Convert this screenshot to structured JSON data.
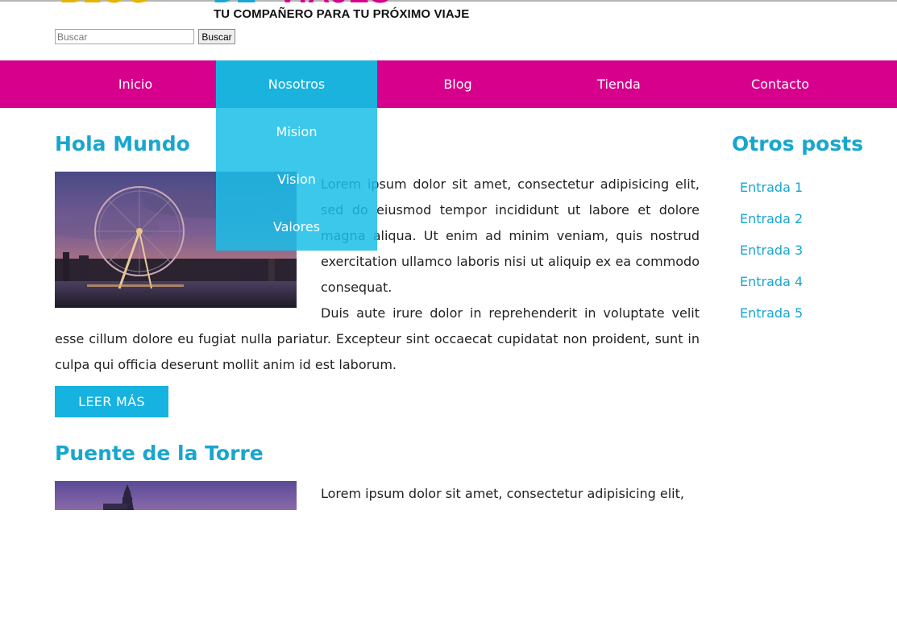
{
  "header": {
    "logo_parts": [
      "BLOG",
      "DE",
      "VIAJES"
    ],
    "tagline": "TU COMPAÑERO PARA TU PRÓXIMO VIAJE",
    "search": {
      "placeholder": "Buscar",
      "button_label": "Buscar"
    }
  },
  "nav": {
    "items": [
      {
        "label": "Inicio"
      },
      {
        "label": "Nosotros",
        "active": true
      },
      {
        "label": "Blog"
      },
      {
        "label": "Tienda"
      },
      {
        "label": "Contacto"
      }
    ],
    "dropdown": [
      "Mision",
      "Vision",
      "Valores"
    ]
  },
  "posts": [
    {
      "title": "Hola Mundo",
      "image": "london-eye-at-dusk",
      "paragraphs": [
        "Lorem ipsum dolor sit amet, consectetur adipisicing elit, sed do eiusmod tempor incididunt ut labore et dolore magna aliqua. Ut enim ad minim veniam, quis nostrud exercitation ullamco laboris nisi ut aliquip ex ea commodo consequat.",
        "Duis aute irure dolor in reprehenderit in voluptate velit esse cillum dolore eu fugiat nulla pariatur. Excepteur sint occaecat cupidatat non proident, sunt in culpa qui officia deserunt mollit anim id est laborum."
      ],
      "button_label": "LEER MÁS"
    },
    {
      "title": "Puente de la Torre",
      "image": "tower-bridge-at-dusk",
      "paragraphs": [
        "Lorem ipsum dolor sit amet, consectetur adipisicing elit,"
      ]
    }
  ],
  "sidebar": {
    "title": "Otros posts",
    "links": [
      "Entrada 1",
      "Entrada 2",
      "Entrada 3",
      "Entrada 4",
      "Entrada 5"
    ]
  },
  "colors": {
    "nav_background": "#d7008c",
    "accent": "#18a6d0",
    "nav_active": "#1ab3de"
  }
}
